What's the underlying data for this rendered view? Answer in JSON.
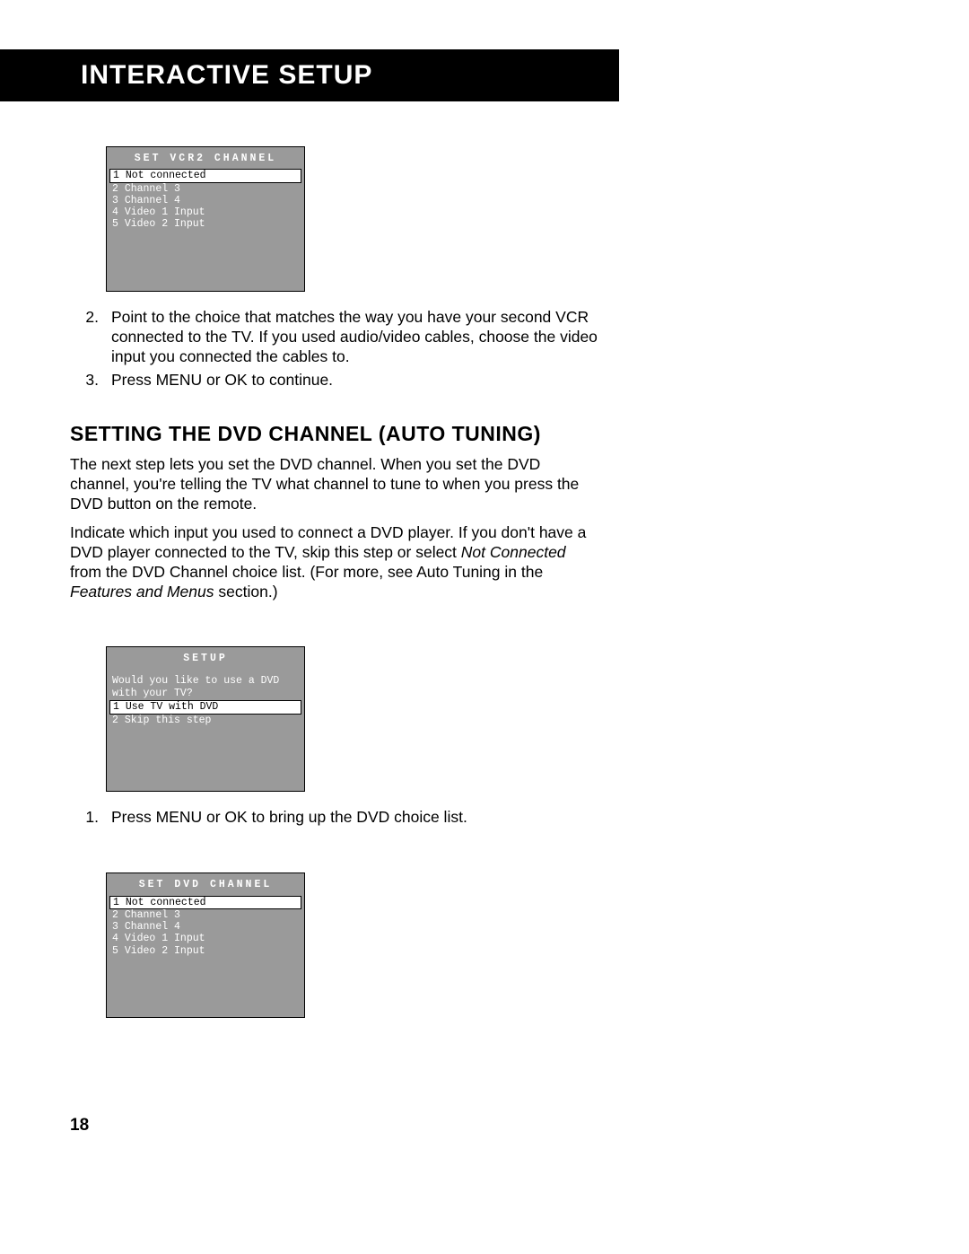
{
  "banner": "Interactive Setup",
  "screen1": {
    "title": "SET VCR2 CHANNEL",
    "items": [
      {
        "n": "1",
        "label": "Not connected",
        "selected": true
      },
      {
        "n": "2",
        "label": "Channel 3"
      },
      {
        "n": "3",
        "label": "Channel 4"
      },
      {
        "n": "4",
        "label": "Video 1 Input"
      },
      {
        "n": "5",
        "label": "Video 2 Input"
      }
    ]
  },
  "steps_a": [
    {
      "n": "2.",
      "text": "Point to the choice that matches the way you have your second VCR connected to the TV.  If you used audio/video cables, choose the video input you connected the cables to."
    },
    {
      "n": "3.",
      "text": "Press MENU or OK to continue."
    }
  ],
  "section_heading": "Setting the DVD Channel (Auto Tuning)",
  "para1": "The next step lets you set the DVD channel. When you set the DVD channel, you're telling the TV what channel to tune to when you press the DVD button on the remote.",
  "para2_a": "Indicate which input you used to connect a DVD player. If you don't have a DVD player connected to the TV, skip this step or select ",
  "para2_i1": "Not Connected",
  "para2_b": " from the DVD Channel choice list. (For more, see Auto Tuning in the ",
  "para2_i2": "Features and Menus",
  "para2_c": " section.)",
  "screen2": {
    "title": "SETUP",
    "prompt": "Would you like to use a DVD with your TV?",
    "items": [
      {
        "n": "1",
        "label": "Use TV with DVD",
        "selected": true
      },
      {
        "n": "2",
        "label": "Skip this step"
      }
    ]
  },
  "steps_b": [
    {
      "n": "1.",
      "text": "Press MENU or OK to bring up the DVD choice list."
    }
  ],
  "screen3": {
    "title": "SET DVD CHANNEL",
    "items": [
      {
        "n": "1",
        "label": "Not connected",
        "selected": true
      },
      {
        "n": "2",
        "label": "Channel 3"
      },
      {
        "n": "3",
        "label": "Channel 4"
      },
      {
        "n": "4",
        "label": "Video 1 Input"
      },
      {
        "n": "5",
        "label": "Video 2 Input"
      }
    ]
  },
  "page_number": "18"
}
